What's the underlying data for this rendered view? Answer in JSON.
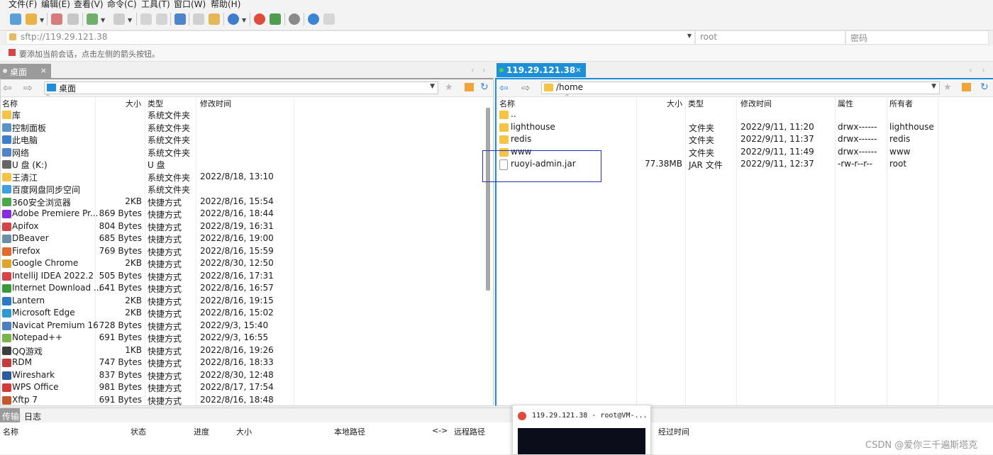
{
  "menu": [
    "文件(F)",
    "编辑(E)",
    "查看(V)",
    "命令(C)",
    "工具(T)",
    "窗口(W)",
    "帮助(H)"
  ],
  "address": {
    "placeholder": "sftp://119.29.121.38",
    "user": "root",
    "password_placeholder": "密码"
  },
  "hint": "要添加当前会话，点击左侧的箭头按钮。",
  "left_tab": {
    "label": "桌面",
    "close": "×"
  },
  "right_tab": {
    "label": "119.29.121.38",
    "close": "×"
  },
  "left_pane": {
    "path": "桌面",
    "columns": {
      "name": "名称",
      "size": "大小",
      "type": "类型",
      "modified": "修改时间"
    },
    "rows": [
      {
        "name": "库",
        "size": "",
        "type": "系统文件夹",
        "modified": ""
      },
      {
        "name": "控制面板",
        "size": "",
        "type": "系统文件夹",
        "modified": ""
      },
      {
        "name": "此电脑",
        "size": "",
        "type": "系统文件夹",
        "modified": ""
      },
      {
        "name": "网络",
        "size": "",
        "type": "系统文件夹",
        "modified": ""
      },
      {
        "name": "U 盘 (K:)",
        "size": "",
        "type": "U 盘",
        "modified": ""
      },
      {
        "name": "王清江",
        "size": "",
        "type": "系统文件夹",
        "modified": "2022/8/18, 13:10"
      },
      {
        "name": "百度网盘同步空间",
        "size": "",
        "type": "系统文件夹",
        "modified": ""
      },
      {
        "name": "360安全浏览器",
        "size": "2KB",
        "type": "快捷方式",
        "modified": "2022/8/16, 15:54"
      },
      {
        "name": "Adobe Premiere Pr...",
        "size": "869 Bytes",
        "type": "快捷方式",
        "modified": "2022/8/16, 18:44"
      },
      {
        "name": "Apifox",
        "size": "804 Bytes",
        "type": "快捷方式",
        "modified": "2022/8/19, 16:31"
      },
      {
        "name": "DBeaver",
        "size": "685 Bytes",
        "type": "快捷方式",
        "modified": "2022/8/16, 19:00"
      },
      {
        "name": "Firefox",
        "size": "769 Bytes",
        "type": "快捷方式",
        "modified": "2022/8/16, 15:59"
      },
      {
        "name": "Google Chrome",
        "size": "2KB",
        "type": "快捷方式",
        "modified": "2022/8/30, 12:50"
      },
      {
        "name": "IntelliJ IDEA 2022.2",
        "size": "505 Bytes",
        "type": "快捷方式",
        "modified": "2022/8/16, 17:31"
      },
      {
        "name": "Internet Download ...",
        "size": "641 Bytes",
        "type": "快捷方式",
        "modified": "2022/8/16, 16:57"
      },
      {
        "name": "Lantern",
        "size": "2KB",
        "type": "快捷方式",
        "modified": "2022/8/16, 19:15"
      },
      {
        "name": "Microsoft Edge",
        "size": "2KB",
        "type": "快捷方式",
        "modified": "2022/8/16, 15:02"
      },
      {
        "name": "Navicat Premium 16",
        "size": "728 Bytes",
        "type": "快捷方式",
        "modified": "2022/9/3, 15:40"
      },
      {
        "name": "Notepad++",
        "size": "691 Bytes",
        "type": "快捷方式",
        "modified": "2022/9/3, 16:55"
      },
      {
        "name": "QQ游戏",
        "size": "1KB",
        "type": "快捷方式",
        "modified": "2022/8/16, 19:26"
      },
      {
        "name": "RDM",
        "size": "747 Bytes",
        "type": "快捷方式",
        "modified": "2022/8/16, 18:33"
      },
      {
        "name": "Wireshark",
        "size": "837 Bytes",
        "type": "快捷方式",
        "modified": "2022/8/30, 12:48"
      },
      {
        "name": "WPS Office",
        "size": "981 Bytes",
        "type": "快捷方式",
        "modified": "2022/8/17, 17:54"
      },
      {
        "name": "Xftp 7",
        "size": "691 Bytes",
        "type": "快捷方式",
        "modified": "2022/8/16, 18:48"
      }
    ]
  },
  "right_pane": {
    "path": "/home",
    "columns": {
      "name": "名称",
      "size": "大小",
      "type": "类型",
      "modified": "修改时间",
      "attr": "属性",
      "owner": "所有者"
    },
    "rows": [
      {
        "name": "..",
        "size": "",
        "type": "",
        "modified": "",
        "attr": "",
        "owner": ""
      },
      {
        "name": "lighthouse",
        "size": "",
        "type": "文件夹",
        "modified": "2022/9/11, 11:20",
        "attr": "drwx------",
        "owner": "lighthouse"
      },
      {
        "name": "redis",
        "size": "",
        "type": "文件夹",
        "modified": "2022/9/11, 11:37",
        "attr": "drwx------",
        "owner": "redis"
      },
      {
        "name": "www",
        "size": "",
        "type": "文件夹",
        "modified": "2022/9/11, 11:49",
        "attr": "drwx------",
        "owner": "www"
      },
      {
        "name": "ruoyi-admin.jar",
        "size": "77.38MB",
        "type": "JAR 文件",
        "modified": "2022/9/11, 12:37",
        "attr": "-rw-r--r--",
        "owner": "root"
      }
    ]
  },
  "bottom": {
    "tabs": [
      "传输",
      "日志"
    ],
    "columns": [
      "名称",
      "状态",
      "进度",
      "大小",
      "本地路径",
      "<->",
      "远程路径",
      "经过时间"
    ]
  },
  "popup": {
    "title": "119.29.121.38 - root@VM-..."
  },
  "watermark": "CSDN @爱你三千遍斯塔克",
  "colors": {
    "accent": "#1b8fd8",
    "selection_box": "#2335b8",
    "folder": "#f6c343"
  }
}
